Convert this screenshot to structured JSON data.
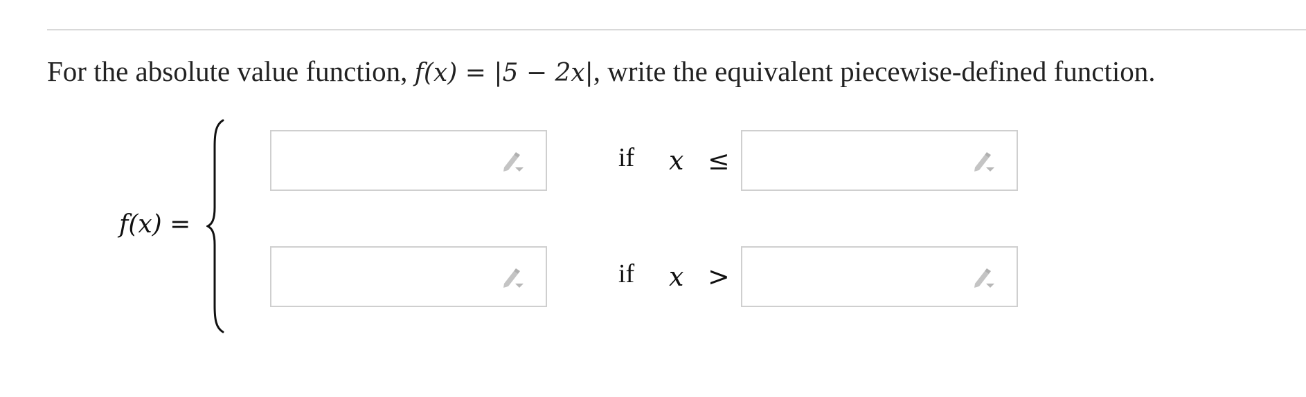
{
  "question": {
    "text_before": "For the absolute value function, ",
    "function_expr": "f(x) = |5 − 2x|",
    "text_after": ", write the equivalent piecewise-defined function."
  },
  "piecewise": {
    "lhs": "f(x) =",
    "rows": [
      {
        "if_label": "if",
        "variable": "x",
        "operator": "≤",
        "expression_value": "",
        "bound_value": ""
      },
      {
        "if_label": "if",
        "variable": "x",
        "operator": ">",
        "expression_value": "",
        "bound_value": ""
      }
    ]
  },
  "icons": {
    "input_tool": "pencil-dropdown-icon"
  },
  "colors": {
    "input_border": "#cfcfcf",
    "icon_gray": "#b7b7b7",
    "rule": "#d9d9d9"
  }
}
